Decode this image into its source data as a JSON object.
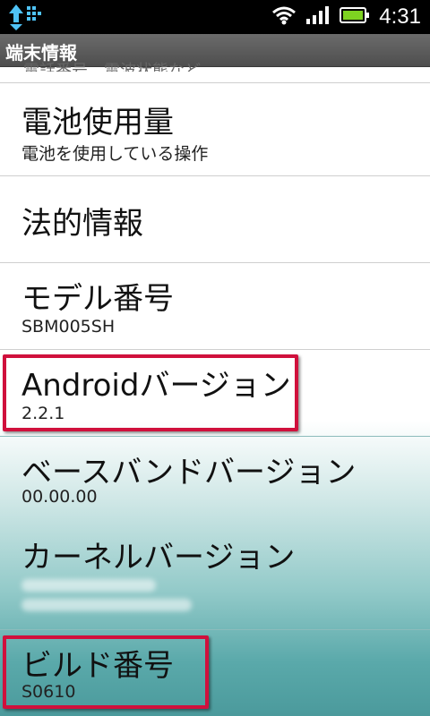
{
  "status": {
    "time": "4:31",
    "icons": [
      "data-sync-icon",
      "wifi-icon",
      "signal-icon",
      "battery-icon"
    ],
    "battery_color": "#7ed321"
  },
  "title": "端末情報",
  "cutoff_text": "電話番号、電波状態など",
  "items": [
    {
      "title": "電池使用量",
      "subtitle": "電池を使用している操作"
    },
    {
      "title": "法的情報",
      "subtitle": ""
    },
    {
      "title": "モデル番号",
      "subtitle": "SBM005SH"
    },
    {
      "title": "Androidバージョン",
      "subtitle": "2.2.1"
    },
    {
      "title": "ベースバンドバージョン",
      "subtitle": "00.00.00"
    },
    {
      "title": "カーネルバージョン",
      "subtitle": ""
    },
    {
      "title": "ビルド番号",
      "subtitle": "S0610"
    }
  ],
  "highlight_color": "#d0103c"
}
